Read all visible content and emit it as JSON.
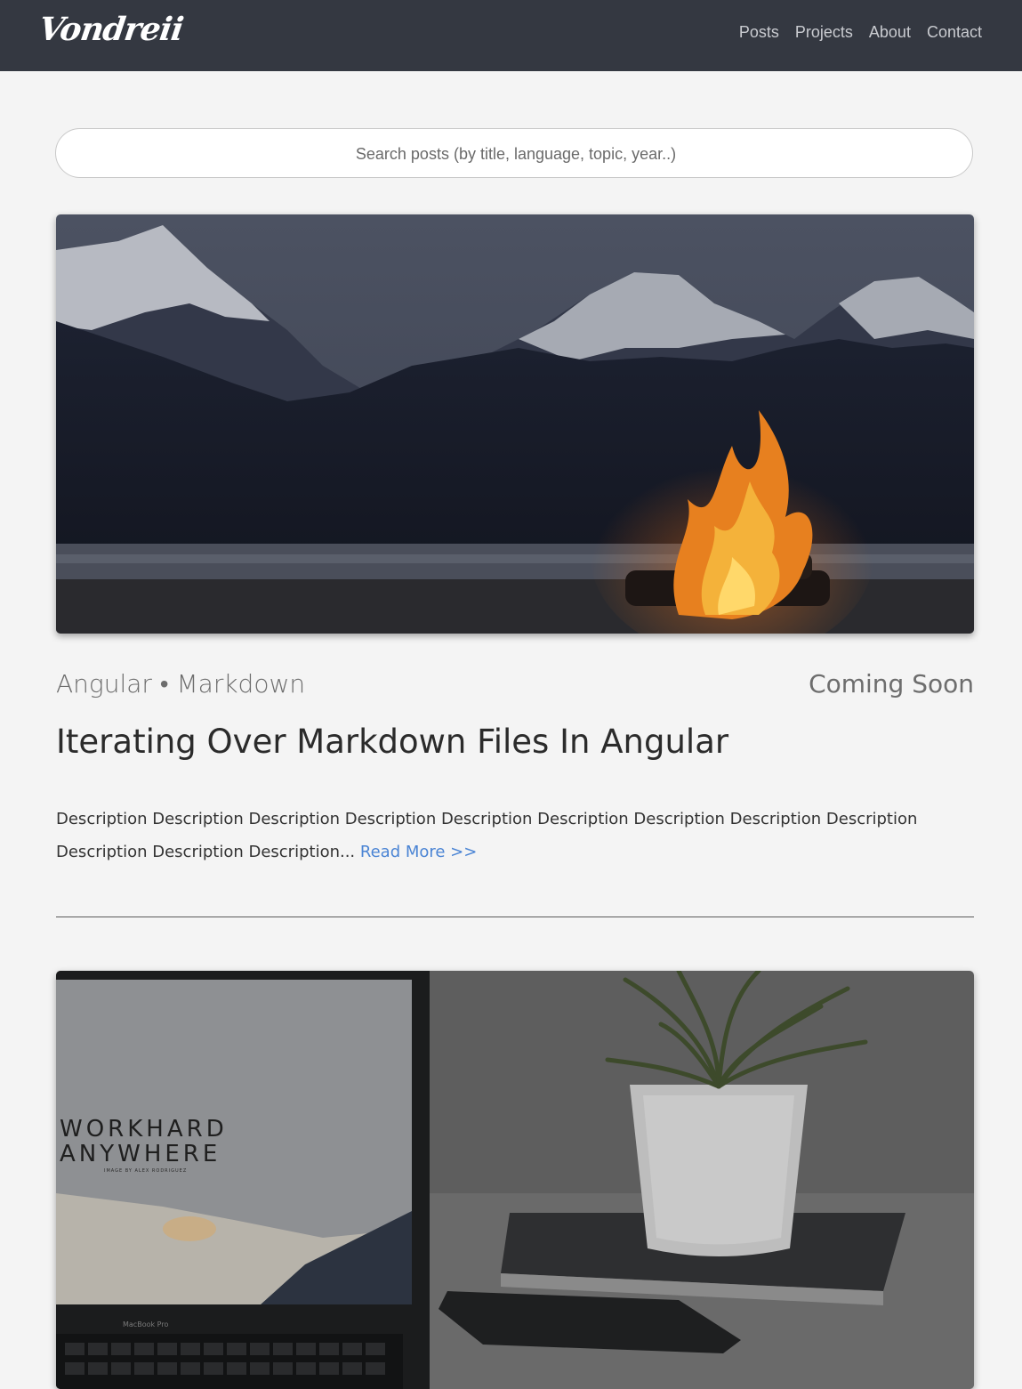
{
  "nav": {
    "brand": "Vondreii",
    "links": [
      "Posts",
      "Projects",
      "About",
      "Contact"
    ]
  },
  "search": {
    "placeholder": "Search posts (by title, language, topic, year..)"
  },
  "posts": [
    {
      "tags": "Angular • Markdown",
      "status": "Coming Soon",
      "title": "Iterating Over Markdown Files In Angular",
      "description": "Description Description Description Description Description Description Description Description Description Description Description Description...",
      "read_more": "Read More >>"
    },
    {
      "laptop_text_1": "WORKHARD",
      "laptop_text_2": "ANYWHERE",
      "laptop_caption": "IMAGE BY ALEX RODRIGUEZ",
      "laptop_model": "MacBook Pro"
    }
  ],
  "colors": {
    "navbar": "#343841",
    "page": "#f4f4f4",
    "link": "#4a84d4"
  }
}
